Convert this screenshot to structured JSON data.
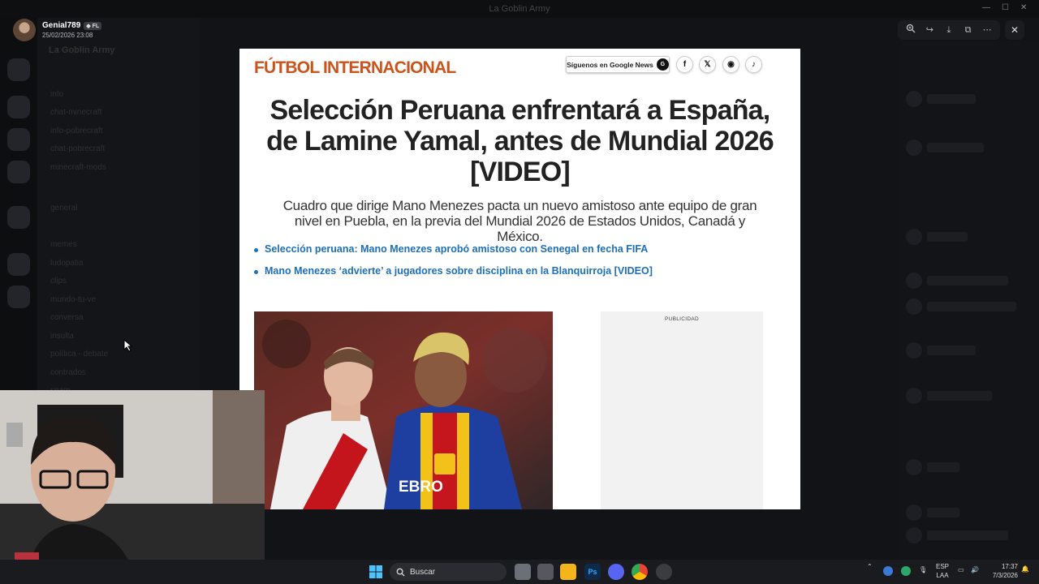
{
  "window": {
    "title": "La Goblin Army"
  },
  "viewer": {
    "username": "Genial789",
    "user_tag": "FL",
    "timestamp": "25/02/2026 23:08",
    "tools": [
      "zoom-in",
      "forward",
      "download",
      "open-external",
      "more"
    ]
  },
  "background": {
    "server_name": "La Goblin Army",
    "channels": [
      "info",
      "chat-minecraft",
      "info-pobrecraft",
      "chat-pobrecraft",
      "minecraft-mods",
      "general",
      "memes",
      "ludopatia",
      "clips",
      "mundo-tu-ve",
      "conversa",
      "insulta",
      "política - debate",
      "contrados",
      "spam"
    ]
  },
  "article": {
    "section": "FÚTBOL INTERNACIONAL",
    "google_news_label": "Síguenos en Google News",
    "headline": "Selección Peruana enfrentará a España, de Lamine Yamal, antes de Mundial 2026 [VIDEO]",
    "subtitle": "Cuadro que dirige Mano Menezes pacta un nuevo amistoso ante equipo de gran nivel en Puebla, en la previa del Mundial 2026 de Estados Unidos, Canadá y México.",
    "related_links": [
      "Selección peruana: Mano Menezes aprobó amistoso con Senegal en fecha FIFA",
      "Mano Menezes ‘advierte’ a jugadores sobre disciplina en la Blanquirroja [VIDEO]"
    ],
    "ad_label": "PUBLICIDAD",
    "photo_jersey_text": "EBRO"
  },
  "taskbar": {
    "search_placeholder": "Buscar",
    "language": "ESP",
    "region": "LAA",
    "time": "17:37",
    "date": "7/3/2026"
  }
}
